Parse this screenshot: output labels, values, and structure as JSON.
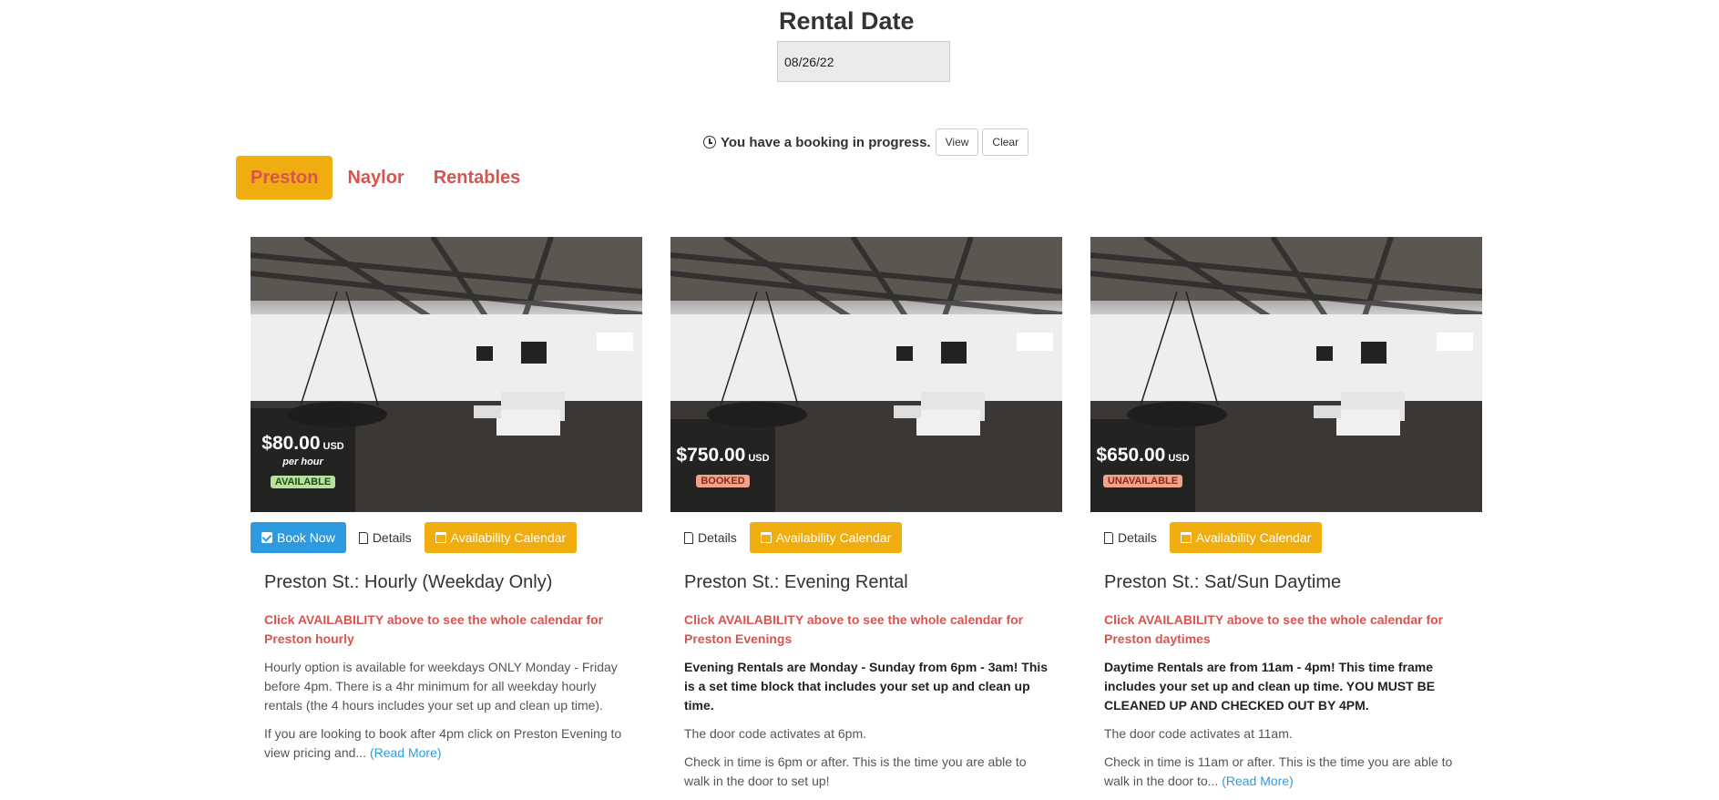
{
  "rental_date": {
    "title": "Rental Date",
    "value": "08/26/22"
  },
  "booking_bar": {
    "message": "You have a booking in progress.",
    "view_label": "View",
    "clear_label": "Clear"
  },
  "tabs": [
    {
      "label": "Preston",
      "active": true
    },
    {
      "label": "Naylor",
      "active": false
    },
    {
      "label": "Rentables",
      "active": false
    }
  ],
  "labels": {
    "book_now": "Book Now",
    "details": "Details",
    "availability": "Availability Calendar",
    "read_more": "(Read More)"
  },
  "cards": [
    {
      "price": "$80.00",
      "currency": "USD",
      "per_hour": "per hour",
      "status": "AVAILABLE",
      "title": "Preston St.: Hourly (Weekday Only)",
      "cta": "Click AVAILABILITY above to see the whole calendar for Preston hourly",
      "p1": "Hourly option is available for weekdays ONLY Monday - Friday before 4pm. There is a 4hr minimum for all weekday hourly rentals (the 4 hours includes your set up and clean up time).",
      "p2": "If you are looking to book after 4pm click on Preston Evening to view pricing and..."
    },
    {
      "price": "$750.00",
      "currency": "USD",
      "status": "BOOKED",
      "title": "Preston St.: Evening Rental",
      "cta": "Click AVAILABILITY above to see the whole calendar for Preston Evenings",
      "p1": "Evening Rentals are Monday - Sunday from 6pm - 3am! This is a set time block that includes your set up and clean up time.",
      "p2": "The door code activates at 6pm.",
      "p3": "Check in time is 6pm or after. This is the time you are able to walk in the door to set up!"
    },
    {
      "price": "$650.00",
      "currency": "USD",
      "status": "UNAVAILABLE",
      "title": "Preston St.: Sat/Sun Daytime",
      "cta": "Click AVAILABILITY above to see the whole calendar for Preston daytimes",
      "p1": "Daytime Rentals are from 11am - 4pm! This time frame includes your set up and clean up time. YOU MUST BE CLEANED UP AND CHECKED OUT BY 4PM.",
      "p2": "The door code activates at 11am.",
      "p3": "Check in time is 11am or after. This is the time you are able to walk in the door to..."
    }
  ]
}
